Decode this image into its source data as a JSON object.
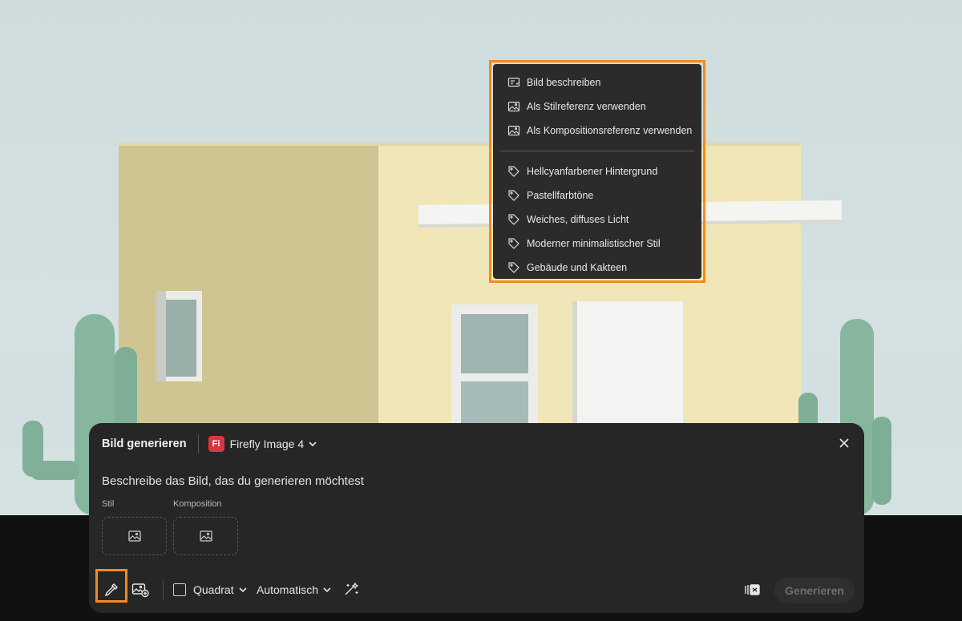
{
  "context_menu": {
    "actions": [
      {
        "label": "Bild beschreiben",
        "icon": "describe-image-icon"
      },
      {
        "label": "Als Stilreferenz verwenden",
        "icon": "image-icon"
      },
      {
        "label": "Als Kompositionsreferenz verwenden",
        "icon": "image-icon"
      }
    ],
    "tags": [
      {
        "label": "Hellcyanfarbener Hintergrund",
        "icon": "tag-icon"
      },
      {
        "label": "Pastellfarbtöne",
        "icon": "tag-icon"
      },
      {
        "label": "Weiches, diffuses Licht",
        "icon": "tag-icon"
      },
      {
        "label": "Moderner minimalistischer Stil",
        "icon": "tag-icon"
      },
      {
        "label": "Gebäude und Kakteen",
        "icon": "tag-icon"
      }
    ]
  },
  "panel": {
    "title": "Bild generieren",
    "model_badge": "Fi",
    "model_name": "Firefly Image 4",
    "prompt_placeholder": "Beschreibe das Bild, das du generieren möchtest",
    "style_label": "Stil",
    "composition_label": "Komposition"
  },
  "toolbar": {
    "aspect_ratio": "Quadrat",
    "content_type": "Automatisch",
    "generate_label": "Generieren"
  },
  "colors": {
    "highlight": "#f28b1d",
    "panel_bg": "#262626",
    "menu_bg": "#2b2b2b",
    "badge_red": "#d7373f",
    "sky": "#cfdcdd"
  }
}
